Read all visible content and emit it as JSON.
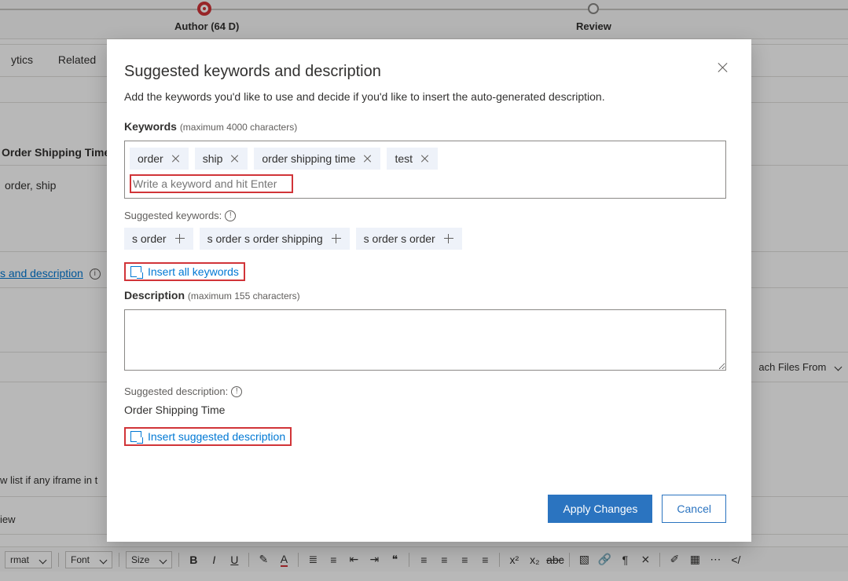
{
  "progress": {
    "author_label": "Author  (64 D)",
    "review_label": "Review"
  },
  "tabs": {
    "analytics": "ytics",
    "related": "Related"
  },
  "bg": {
    "heading1": "Order Shipping Time",
    "text1": "order, ship",
    "link1": "s and description",
    "attach": "ach Files From",
    "iframe_text": "w list if any iframe in t",
    "preview": "iew"
  },
  "toolbar": {
    "format": "rmat",
    "font": "Font",
    "size": "Size"
  },
  "modal": {
    "title": "Suggested keywords and description",
    "subtitle": "Add the keywords you'd like to use and decide if you'd like to insert the auto-generated description.",
    "keywords_label": "Keywords",
    "keywords_hint": "(maximum 4000 characters)",
    "keyword_chips": [
      {
        "label": "order"
      },
      {
        "label": "ship"
      },
      {
        "label": "order shipping time"
      },
      {
        "label": "test"
      }
    ],
    "keyword_placeholder": "Write a keyword and hit Enter",
    "suggested_keywords_label": "Suggested keywords:",
    "suggested_keywords": [
      {
        "label": "s order"
      },
      {
        "label": "s order s order shipping"
      },
      {
        "label": "s order s order"
      }
    ],
    "insert_all": "Insert all keywords",
    "description_label": "Description",
    "description_hint": "(maximum 155 characters)",
    "suggested_description_label": "Suggested description:",
    "suggested_description_value": "Order Shipping Time",
    "insert_desc": "Insert suggested description",
    "apply": "Apply Changes",
    "cancel": "Cancel"
  }
}
